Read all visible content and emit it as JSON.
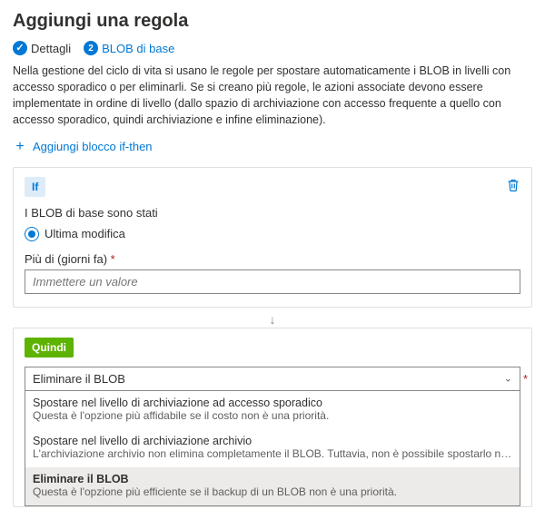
{
  "title": "Aggiungi una regola",
  "stepper": {
    "step1_label": "Dettagli",
    "step2_number": "2",
    "step2_label": "BLOB di base"
  },
  "intro": "Nella gestione del ciclo di vita si usano le regole per spostare automaticamente i BLOB in livelli con accesso sporadico o per eliminarli. Se si creano più regole, le azioni associate devono essere implementate in ordine di livello (dallo spazio di archiviazione con accesso frequente a quello con accesso sporadico, quindi archiviazione e infine eliminazione).",
  "add_block_label": "Aggiungi blocco if-then",
  "if_panel": {
    "badge": "If",
    "heading": "I BLOB di base sono stati",
    "radio_label": "Ultima modifica",
    "days_label": "Più di (giorni fa)",
    "days_required_mark": "*",
    "days_placeholder": "Immettere un valore"
  },
  "connector_arrow": "↓",
  "then_panel": {
    "badge": "Quindi",
    "selected_value": "Eliminare il BLOB",
    "required_mark": "*",
    "options": [
      {
        "title": "Spostare nel livello di archiviazione ad accesso sporadico",
        "desc": "Questa è l'opzione più affidabile se il costo non è una priorità."
      },
      {
        "title": "Spostare nel livello di archiviazione archivio",
        "desc": "L'archiviazione archivio non elimina completamente il BLOB. Tuttavia, non è possibile spostarlo nuo..."
      },
      {
        "title": "Eliminare il BLOB",
        "desc": "Questa è l'opzione più efficiente se il backup di un BLOB non è una priorità."
      }
    ]
  }
}
